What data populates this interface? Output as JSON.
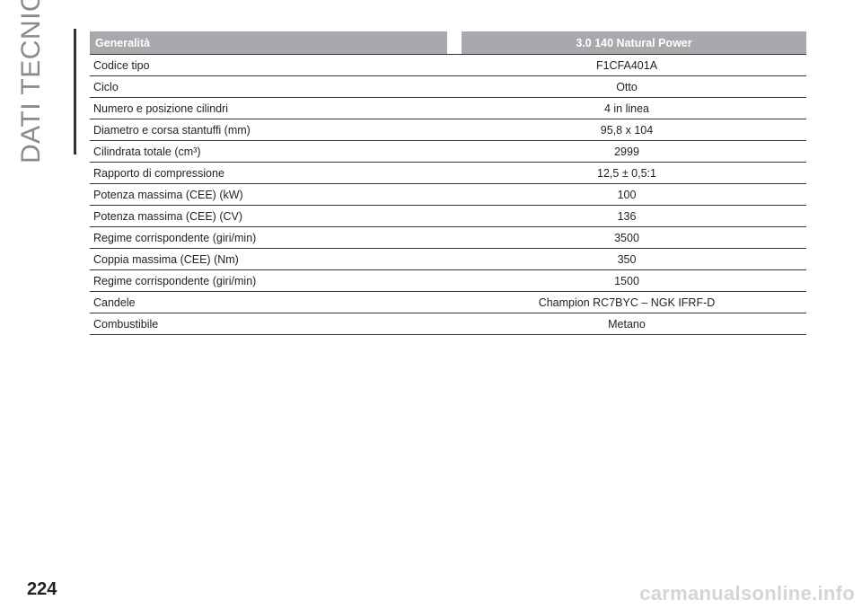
{
  "section_title": "DATI TECNICI",
  "table": {
    "headers": {
      "label": "Generalità",
      "value": "3.0 140 Natural Power"
    },
    "rows": [
      {
        "label": "Codice tipo",
        "value": "F1CFA401A"
      },
      {
        "label": "Ciclo",
        "value": "Otto"
      },
      {
        "label": "Numero e posizione cilindri",
        "value": "4 in linea"
      },
      {
        "label": "Diametro e corsa stantuffi (mm)",
        "value": "95,8 x 104"
      },
      {
        "label": "Cilindrata totale (cm³)",
        "value": "2999"
      },
      {
        "label": "Rapporto di compressione",
        "value": "12,5 ± 0,5:1"
      },
      {
        "label": "Potenza massima (CEE) (kW)",
        "value": "100"
      },
      {
        "label": "Potenza massima (CEE) (CV)",
        "value": "136"
      },
      {
        "label": "Regime corrispondente (giri/min)",
        "value": "3500"
      },
      {
        "label": "Coppia massima (CEE) (Nm)",
        "value": "350"
      },
      {
        "label": "Regime corrispondente (giri/min)",
        "value": "1500"
      },
      {
        "label": "Candele",
        "value": "Champion RC7BYC – NGK IFRF-D"
      },
      {
        "label": "Combustibile",
        "value": "Metano"
      }
    ]
  },
  "page_number": "224",
  "watermark": "carmanualsonline.info",
  "colors": {
    "header_bg": "#a7a9ac",
    "rule": "#333333",
    "side_title": "#8a8a8a"
  }
}
